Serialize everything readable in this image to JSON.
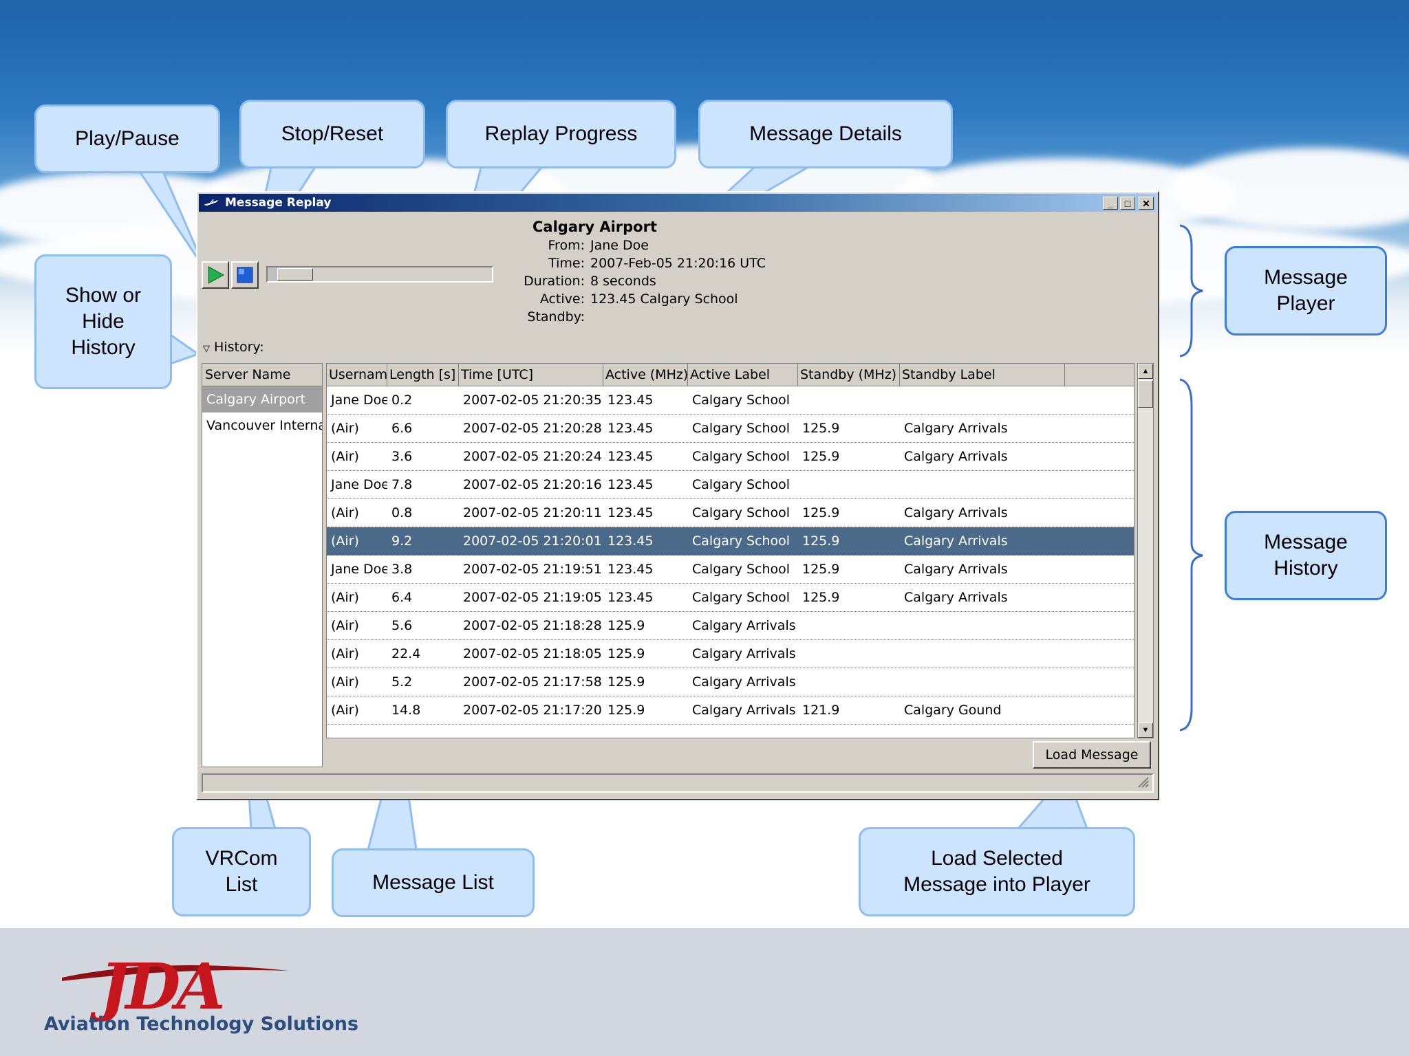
{
  "window": {
    "title": "Message Replay"
  },
  "player": {
    "progress_fraction": 0.05,
    "airport": "Calgary Airport",
    "details": [
      {
        "label": "From:",
        "value": "Jane Doe"
      },
      {
        "label": "Time:",
        "value": "2007-Feb-05 21:20:16 UTC"
      },
      {
        "label": "Duration:",
        "value": "8 seconds"
      },
      {
        "label": "Active:",
        "value": "123.45 Calgary School"
      },
      {
        "label": "Standby:",
        "value": ""
      }
    ]
  },
  "history": {
    "toggle_label": "History:",
    "server_header": "Server Name",
    "servers": [
      "Calgary Airport",
      "Vancouver International"
    ],
    "selected_server": 0,
    "columns": [
      "Username",
      "Length [s]",
      "Time [UTC]",
      "Active (MHz)",
      "Active Label",
      "Standby (MHz)",
      "Standby Label"
    ],
    "rows": [
      [
        "Jane Doe",
        "0.2",
        "2007-02-05 21:20:35",
        "123.45",
        "Calgary School",
        "",
        ""
      ],
      [
        "(Air)",
        "6.6",
        "2007-02-05 21:20:28",
        "123.45",
        "Calgary School",
        "125.9",
        "Calgary Arrivals"
      ],
      [
        "(Air)",
        "3.6",
        "2007-02-05 21:20:24",
        "123.45",
        "Calgary School",
        "125.9",
        "Calgary Arrivals"
      ],
      [
        "Jane Doe",
        "7.8",
        "2007-02-05 21:20:16",
        "123.45",
        "Calgary School",
        "",
        ""
      ],
      [
        "(Air)",
        "0.8",
        "2007-02-05 21:20:11",
        "123.45",
        "Calgary School",
        "125.9",
        "Calgary Arrivals"
      ],
      [
        "(Air)",
        "9.2",
        "2007-02-05 21:20:01",
        "123.45",
        "Calgary School",
        "125.9",
        "Calgary Arrivals"
      ],
      [
        "Jane Doe",
        "3.8",
        "2007-02-05 21:19:51",
        "123.45",
        "Calgary School",
        "125.9",
        "Calgary Arrivals"
      ],
      [
        "(Air)",
        "6.4",
        "2007-02-05 21:19:05",
        "123.45",
        "Calgary School",
        "125.9",
        "Calgary Arrivals"
      ],
      [
        "(Air)",
        "5.6",
        "2007-02-05 21:18:28",
        "125.9",
        "Calgary Arrivals",
        "",
        ""
      ],
      [
        "(Air)",
        "22.4",
        "2007-02-05 21:18:05",
        "125.9",
        "Calgary Arrivals",
        "",
        ""
      ],
      [
        "(Air)",
        "5.2",
        "2007-02-05 21:17:58",
        "125.9",
        "Calgary Arrivals",
        "",
        ""
      ],
      [
        "(Air)",
        "14.8",
        "2007-02-05 21:17:20",
        "125.9",
        "Calgary Arrivals",
        "121.9",
        "Calgary Gound"
      ]
    ],
    "selected_row": 5,
    "load_button": "Load Message"
  },
  "callouts": {
    "play_pause": "Play/Pause",
    "stop_reset": "Stop/Reset",
    "replay_progress": "Replay Progress",
    "message_details": "Message Details",
    "show_hide_history": "Show or Hide History",
    "message_player": "Message Player",
    "message_history": "Message History",
    "vrcom_list": "VRCom List",
    "message_list": "Message List",
    "load_selected": "Load Selected Message into Player"
  },
  "branding": {
    "logo_text": "JDA",
    "tagline": "Aviation Technology Solutions",
    "logo_color": "#c4161c",
    "tagline_color": "#2c4d7d"
  }
}
